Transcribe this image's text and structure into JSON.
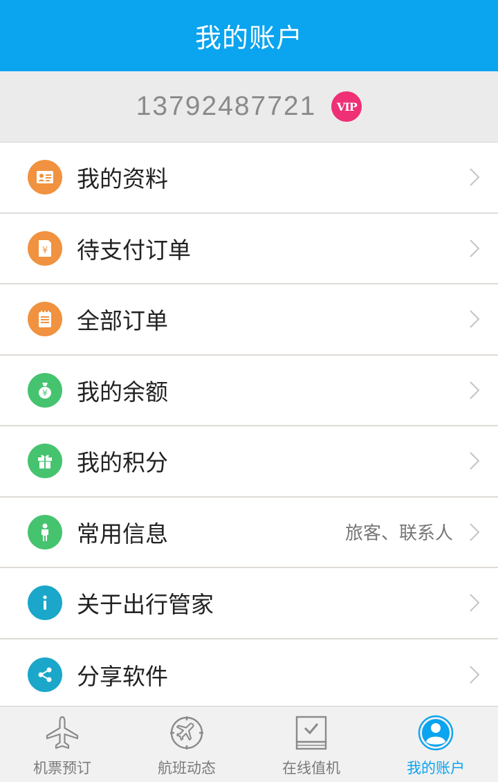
{
  "header": {
    "title": "我的账户"
  },
  "account": {
    "phone": "13792487721",
    "badge": "VIP"
  },
  "menu": [
    {
      "label": "我的资料",
      "sub": "",
      "icon": "profile-card-icon",
      "color": "#f0923f"
    },
    {
      "label": "待支付订单",
      "sub": "",
      "icon": "unpaid-bill-icon",
      "color": "#f0923f"
    },
    {
      "label": "全部订单",
      "sub": "",
      "icon": "order-list-icon",
      "color": "#f0923f"
    },
    {
      "label": "我的余额",
      "sub": "",
      "icon": "money-bag-icon",
      "color": "#46c36e"
    },
    {
      "label": "我的积分",
      "sub": "",
      "icon": "gift-icon",
      "color": "#46c36e"
    },
    {
      "label": "常用信息",
      "sub": "旅客、联系人",
      "icon": "person-icon",
      "color": "#46c36e"
    },
    {
      "label": "关于出行管家",
      "sub": "",
      "icon": "info-icon",
      "color": "#1aa7c9"
    },
    {
      "label": "分享软件",
      "sub": "",
      "icon": "share-icon",
      "color": "#1aa7c9"
    }
  ],
  "tabs": [
    {
      "label": "机票预订",
      "icon": "plane-icon",
      "active": false
    },
    {
      "label": "航班动态",
      "icon": "flight-compass-icon",
      "active": false
    },
    {
      "label": "在线值机",
      "icon": "checkin-icon",
      "active": false
    },
    {
      "label": "我的账户",
      "icon": "account-icon",
      "active": true
    }
  ],
  "colors": {
    "accent": "#0aa4ef",
    "vip": "#ef2f76",
    "inactive_tab": "#7a7a7a"
  }
}
